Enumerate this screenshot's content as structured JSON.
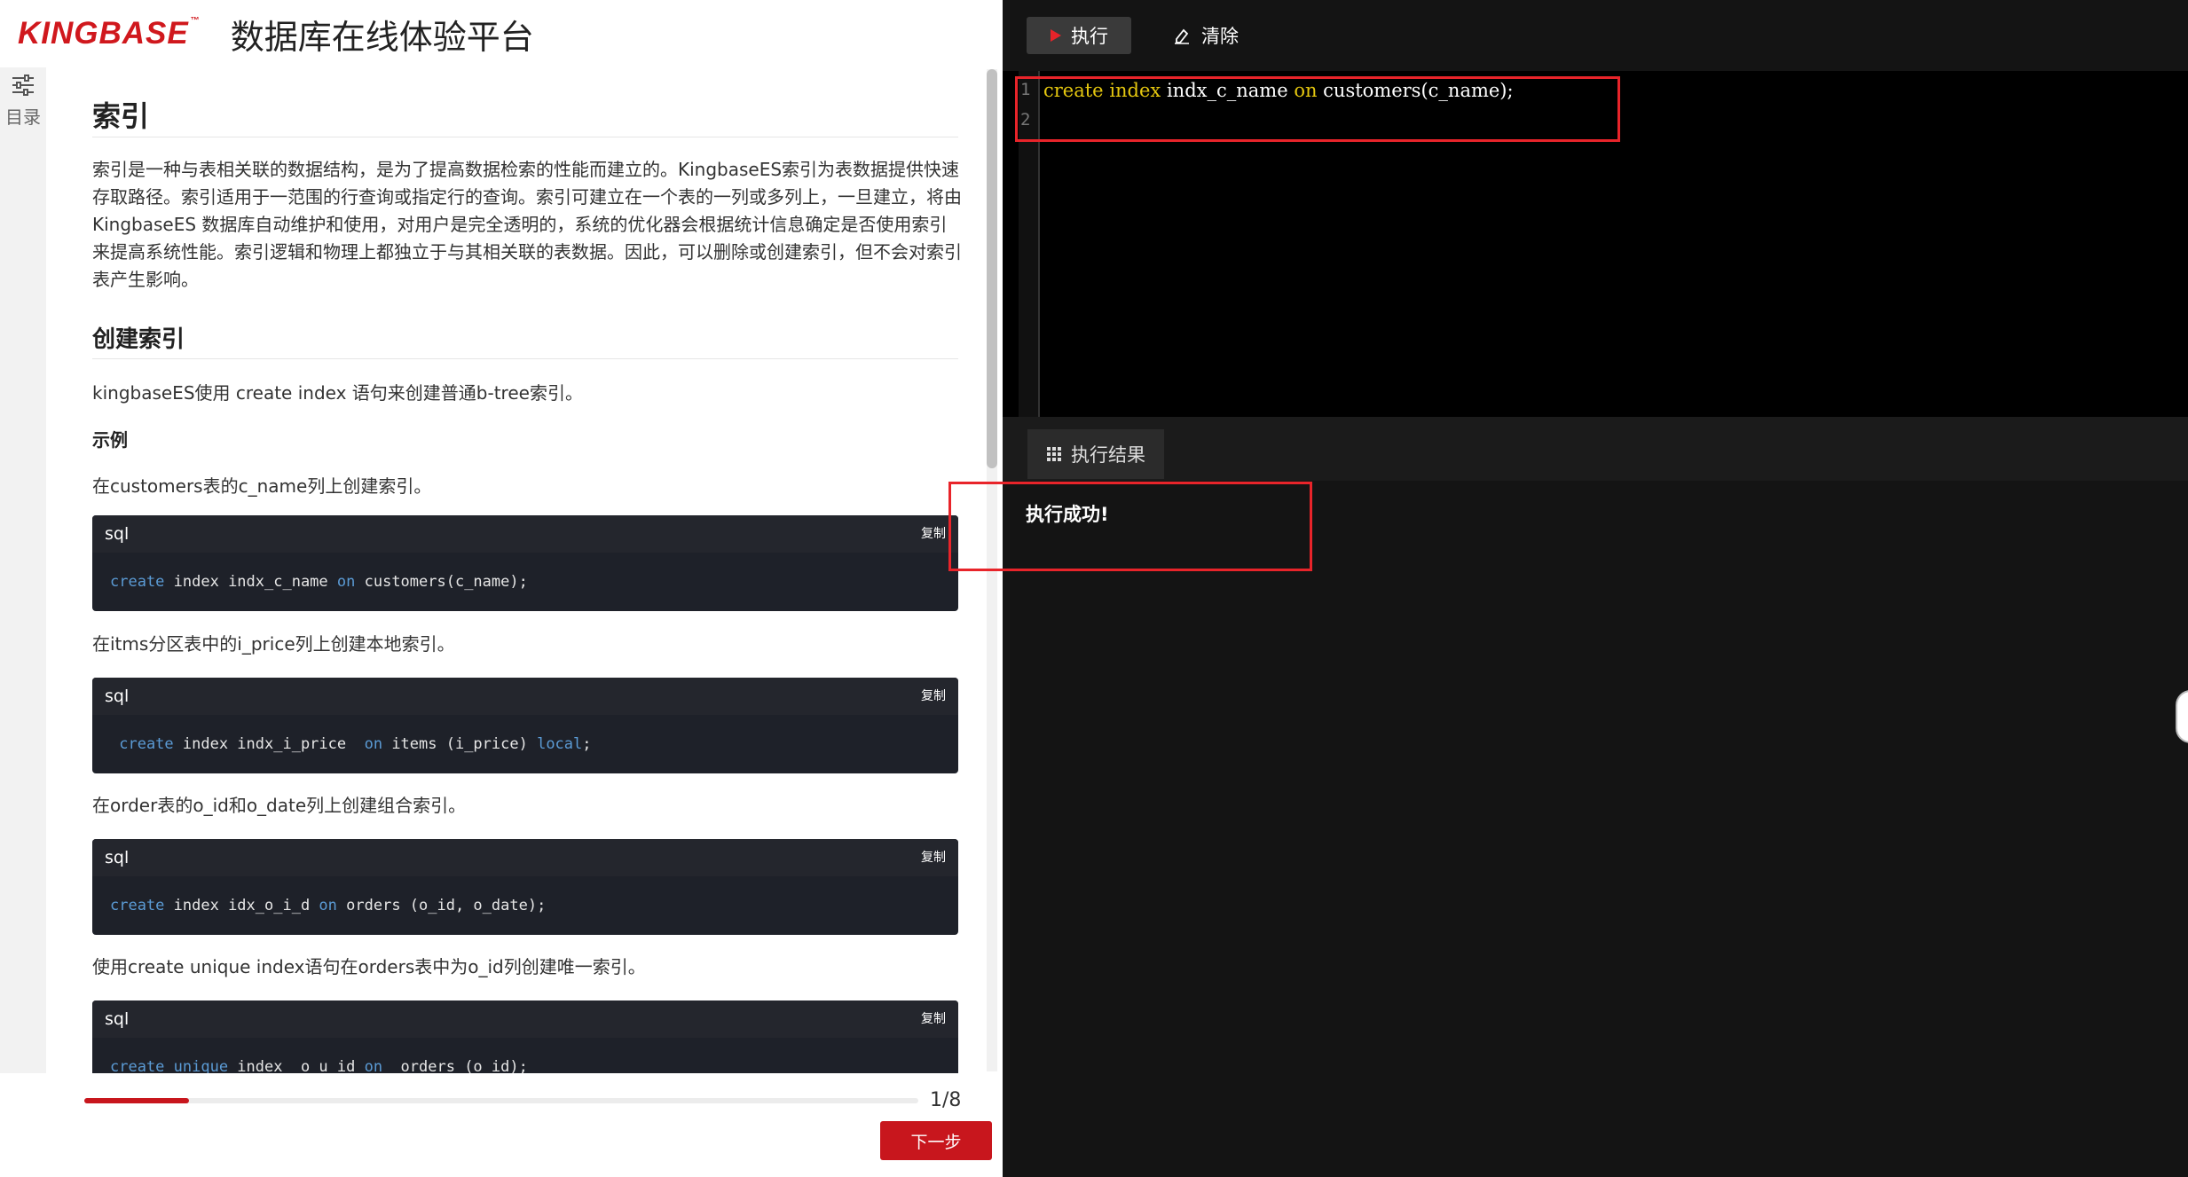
{
  "header": {
    "logo": "KINGBASE",
    "logo_tm": "™",
    "title": "数据库在线体验平台"
  },
  "toc": {
    "label": "目录",
    "icon": "sliders-icon"
  },
  "article": {
    "h1": "索引",
    "intro": "索引是一种与表相关联的数据结构，是为了提高数据检索的性能而建立的。KingbaseES索引为表数据提供快速存取路径。索引适用于一范围的行查询或指定行的查询。索引可建立在一个表的一列或多列上，一旦建立，将由 KingbaseES 数据库自动维护和使用，对用户是完全透明的，系统的优化器会根据统计信息确定是否使用索引来提高系统性能。索引逻辑和物理上都独立于与其相关联的表数据。因此，可以删除或创建索引，但不会对索引表产生影响。",
    "h2": "创建索引",
    "desc": "kingbaseES使用 create index 语句来创建普通b-tree索引。",
    "example_label": "示例",
    "steps": [
      {
        "text": "在customers表的c_name列上创建索引。",
        "lang": "sql",
        "copy": "复制",
        "kw1": "create",
        "p1": " index indx_c_name ",
        "kw2": "on",
        "p2": " customers(c_name);",
        "kw3": "",
        "p3": ""
      },
      {
        "text": "在itms分区表中的i_price列上创建本地索引。",
        "lang": "sql",
        "copy": "复制",
        "kw1": " create",
        "p1": " index indx_i_price  ",
        "kw2": "on",
        "p2": " items (i_price) ",
        "kw3": "local",
        "p3": ";"
      },
      {
        "text": "在order表的o_id和o_date列上创建组合索引。",
        "lang": "sql",
        "copy": "复制",
        "kw1": "create",
        "p1": " index idx_o_i_d ",
        "kw2": "on",
        "p2": " orders (o_id, o_date);",
        "kw3": "",
        "p3": ""
      },
      {
        "text": "使用create unique index语句在orders表中为o_id列创建唯一索引。",
        "lang": "sql",
        "copy": "复制",
        "kw1": "create unique",
        "p1": " index  o_u_id ",
        "kw2": "on",
        "p2": "  orders (o_id);",
        "kw3": "",
        "p3": ""
      }
    ]
  },
  "progress": {
    "current": 1,
    "total": 8,
    "label": "1/8",
    "fraction": 0.125
  },
  "next_button": "下一步",
  "editor": {
    "run_label": "执行",
    "clear_label": "清除",
    "line_numbers": [
      "1",
      "2"
    ],
    "line1": {
      "k1": "create",
      "t1": " ",
      "k2": "index",
      "t2": " indx_c_name ",
      "k3": "on",
      "t3": " customers(c_name);"
    }
  },
  "result": {
    "tab_label": "执行结果",
    "message": "执行成功!"
  },
  "colors": {
    "brand_red": "#c8161d",
    "keyword_blue": "#5b9bd5",
    "editor_keyword": "#e5c70f",
    "annotation_red": "#e8242a"
  }
}
